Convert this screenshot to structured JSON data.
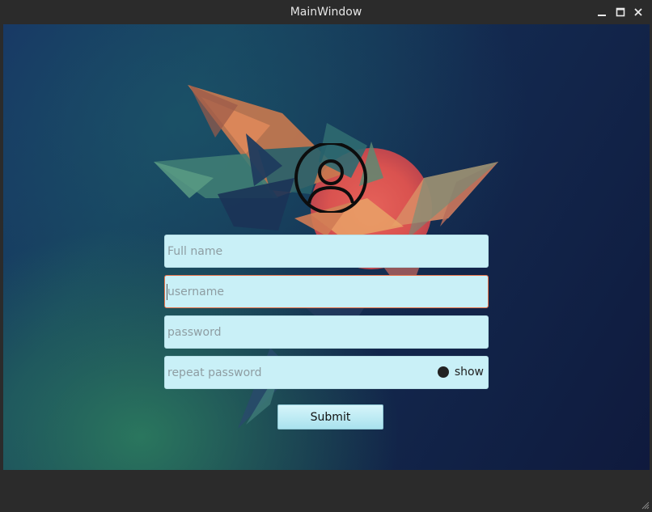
{
  "window": {
    "title": "MainWindow",
    "controls": [
      "minimize-icon",
      "maximize-icon",
      "close-icon"
    ]
  },
  "form": {
    "fullname_placeholder": "Full name",
    "username_placeholder": "username",
    "password_placeholder": "password",
    "repeat_password_placeholder": "repeat password",
    "show_label": "show",
    "submit_label": "Submit"
  },
  "icons": {
    "avatar": "user-circle-icon"
  },
  "colors": {
    "field_bg": "#c9f0f7",
    "focus_border": "#e9754c",
    "titlebar": "#2b2b2b"
  }
}
